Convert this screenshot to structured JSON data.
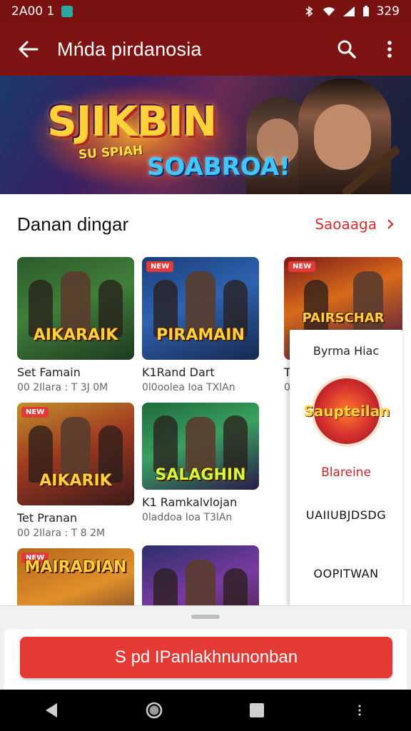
{
  "status_bar": {
    "time": "2A00 1",
    "battery": "329",
    "icons": [
      "notification-icon",
      "bluetooth-icon",
      "wifi-icon",
      "signal-icon",
      "battery-icon"
    ]
  },
  "app_bar": {
    "title": "Mńda pirdanosia",
    "icons": [
      "back-arrow-icon",
      "search-icon",
      "more-vert-icon"
    ]
  },
  "banner": {
    "title": "SJIKBIN",
    "tagline_1": "SU SPIAH",
    "tagline_2": "SOABROA!"
  },
  "section": {
    "title": "Danan dingar",
    "see_all": "Saoaaga"
  },
  "games": [
    {
      "thumb_title": "AIKARAIK",
      "name": "Set Famain",
      "meta": "00 2Ilara : T 3J 0M",
      "badge": ""
    },
    {
      "thumb_title": "PIRAMAIN",
      "name": "K1Rand Dart",
      "meta": "0l0oolea Ioa TXlAn",
      "badge": "NEW"
    },
    {
      "thumb_title": "PAIRSCHAR",
      "name": "T",
      "meta": "0",
      "badge": "NEW"
    },
    {
      "thumb_title": "AIKARIK",
      "name": "Tet Pranan",
      "meta": "00 2Ilara : T 8 2M",
      "badge": "NEW"
    },
    {
      "thumb_title": "SALAGHIN",
      "name": "K1 Ramkalvlojan",
      "meta": "0laddoa Ioa T3lAn",
      "badge": ""
    },
    {
      "thumb_title": "MAIRADIAN",
      "name": "",
      "meta": "",
      "badge": "NEW"
    },
    {
      "thumb_title": "",
      "name": "",
      "meta": "",
      "badge": ""
    }
  ],
  "popup": {
    "header": "Byrma Hiac",
    "emblem_text": "Saupteilan",
    "red_item": "Blareine",
    "item_1": "UAIIUBJDSDG",
    "item_2": "OOPITWAN"
  },
  "cta": {
    "label": "S pd IPanlakhnunonban"
  },
  "nav": {
    "icons": [
      "back-triangle-icon",
      "home-circle-icon",
      "recents-square-icon",
      "menu-dots-icon"
    ]
  },
  "colors": {
    "brand": "#7d1313",
    "accent": "#e53935",
    "link": "#d32f2f"
  }
}
